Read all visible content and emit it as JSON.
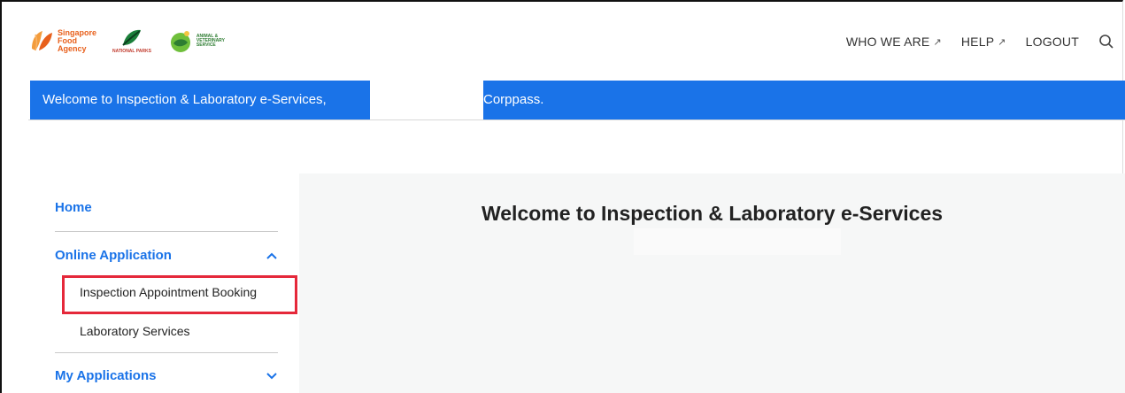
{
  "logos": {
    "sfa": {
      "line1": "Singapore",
      "line2": "Food",
      "line3": "Agency"
    },
    "nparks": {
      "text": "NATIONAL PARKS"
    },
    "avs": {
      "line1": "ANIMAL &",
      "line2": "VETERINARY",
      "line3": "SERVICE"
    }
  },
  "nav": {
    "who_we_are": "WHO WE ARE",
    "help": "HELP",
    "logout": "LOGOUT",
    "external_glyph": "↗"
  },
  "banner": {
    "left_text": "Welcome to Inspection & Laboratory e-Services,",
    "right_text": "Corppass."
  },
  "sidebar": {
    "home": "Home",
    "online_application": "Online Application",
    "sub_items": [
      "Inspection Appointment Booking",
      "Laboratory Services"
    ],
    "my_applications": "My Applications"
  },
  "main": {
    "title": "Welcome to Inspection & Laboratory e-Services"
  },
  "colors": {
    "accent": "#1a73e8",
    "highlight": "#e5283a",
    "panel": "#f6f7f7"
  }
}
